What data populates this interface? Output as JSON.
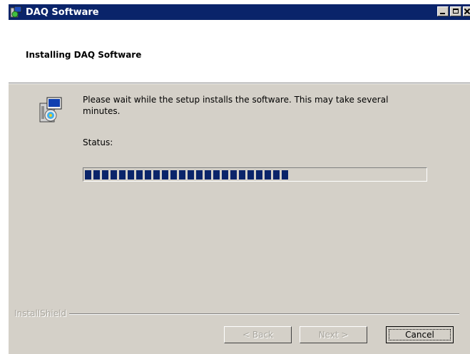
{
  "window": {
    "title": "DAQ Software"
  },
  "header": {
    "title": "Installing DAQ Software"
  },
  "main": {
    "message": "Please wait while the setup  installs the software. This may take several minutes.",
    "status_label": "Status:",
    "progress_fraction": 0.6
  },
  "footer": {
    "brand": "InstallShield",
    "back_label": "< Back",
    "next_label": "Next >",
    "cancel_label": "Cancel"
  },
  "icons": [
    "setup-icon",
    "minimize-icon",
    "maximize-icon",
    "close-icon"
  ],
  "colors": {
    "titlebar": "#0a246a",
    "progress": "#0a246a",
    "dialog": "#d4d0c8"
  }
}
